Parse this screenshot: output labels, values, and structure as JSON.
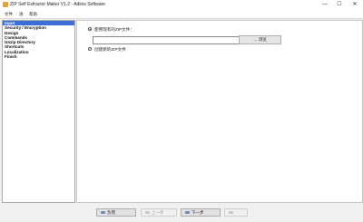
{
  "window": {
    "title": "ZIP Self Extractor Maker V1.2 - Adinis Software",
    "minimize": "—",
    "maximize": "☐",
    "close": "✕"
  },
  "menu": [
    "文件",
    "语",
    "帮助"
  ],
  "sidebar": {
    "items": [
      {
        "label": "Input",
        "selected": true
      },
      {
        "label": "Security / Encryption",
        "selected": false
      },
      {
        "label": "Design",
        "selected": false
      },
      {
        "label": "Commands",
        "selected": false
      },
      {
        "label": "Unzip Directory",
        "selected": false
      },
      {
        "label": "Shortcuts",
        "selected": false
      },
      {
        "label": "Localization",
        "selected": false
      },
      {
        "label": "Finish",
        "selected": false
      }
    ]
  },
  "main": {
    "option_existing": "使用现有的ZIP文件：",
    "option_new": "创建新的ZIP文件",
    "path_value": "",
    "browse_label": "浏览"
  },
  "bottom": {
    "load_label": "负荷",
    "back_label": "上一步",
    "next_label": "下一步",
    "icon_color": "#6b8fbf"
  },
  "colors": {
    "selection": "#3a6fd8",
    "app_icon": "#e8a23a"
  }
}
